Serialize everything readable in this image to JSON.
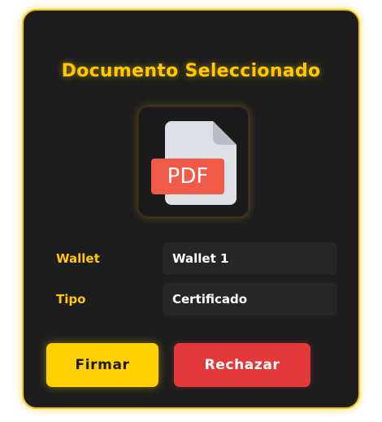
{
  "panel": {
    "title": "Documento Seleccionado",
    "document_icon": {
      "name": "pdf-file-icon",
      "badge_text": "PDF",
      "badge_color": "#f05a48"
    },
    "fields": [
      {
        "label": "Wallet",
        "value": "Wallet 1"
      },
      {
        "label": "Tipo",
        "value": "Certificado"
      }
    ],
    "actions": {
      "sign_label": "Firmar",
      "reject_label": "Rechazar"
    }
  },
  "colors": {
    "accent": "#ffc800",
    "card_background": "#1d1d1d",
    "reject": "#e23a3a"
  }
}
